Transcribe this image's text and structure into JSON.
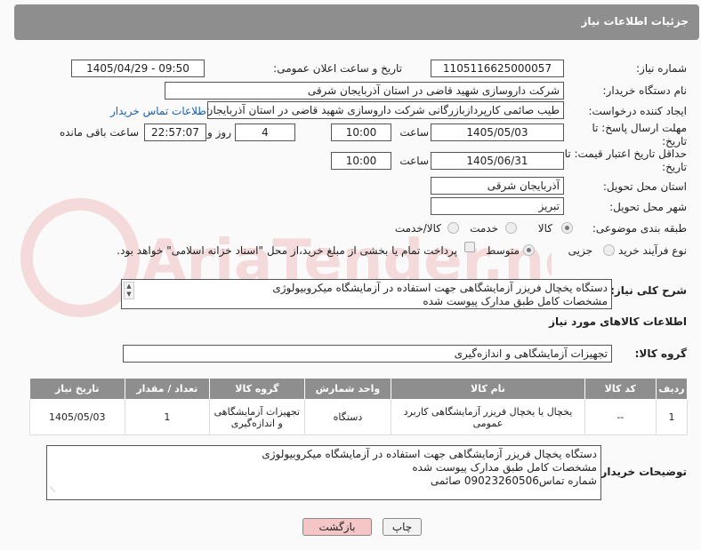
{
  "header": {
    "title": "جزئیات اطلاعات نیاز"
  },
  "fields": {
    "need_number_label": "شماره نیاز:",
    "need_number": "1105116625000057",
    "announce_label": "تاریخ و ساعت اعلان عمومی:",
    "announce_value": "1405/04/29 - 09:50",
    "buyer_org_label": "نام دستگاه خریدار:",
    "buyer_org": "شرکت داروسازی شهید قاضی در استان آذربایجان شرقی",
    "creator_label": "ایجاد کننده درخواست:",
    "creator": "طیب صائمی کارپردازبازرگانی شرکت داروسازی شهید قاضی در استان آذربایجان",
    "contact_link": "اطلاعات تماس خریدار",
    "deadline_label": "مهلت ارسال پاسخ: تا تاریخ:",
    "deadline_date": "1405/05/03",
    "time_label": "ساعت",
    "deadline_time": "10:00",
    "days_value": "4",
    "days_label": "روز و",
    "remaining_time": "22:57:07",
    "remaining_label": "ساعت باقی مانده",
    "validity_label": "حداقل تاریخ اعتبار قیمت: تا تاریخ:",
    "validity_date": "1405/06/31",
    "validity_time": "10:00",
    "province_label": "استان محل تحویل:",
    "province": "آذربایجان شرقی",
    "city_label": "شهر محل تحویل:",
    "city": "تبریز",
    "category_label": "طبقه بندی موضوعی:",
    "category_options": [
      "کالا",
      "خدمت",
      "کالا/خدمت"
    ],
    "process_label": "نوع فرآیند خرید :",
    "process_options": [
      "جزیی",
      "متوسط"
    ],
    "payment_note": "پرداخت تمام یا بخشی از مبلغ خرید،از محل \"اسناد خزانه اسلامی\" خواهد بود."
  },
  "general_desc": {
    "label": "شرح کلی نیاز:",
    "line1": "دستگاه یخچال فریزر آزمایشگاهی جهت استفاده در آزمایشگاه میکروبیولوژی",
    "line2": "مشخصات کامل طبق مدارک پیوست شده"
  },
  "goods_section": {
    "title": "اطلاعات کالاهای مورد نیاز",
    "group_label": "گروه کالا:",
    "group_value": "تجهیزات آزمایشگاهی و اندازه‌گیری"
  },
  "table": {
    "headers": [
      "ردیف",
      "کد کالا",
      "نام کالا",
      "واحد شمارش",
      "گروه کالا",
      "تعداد / مقدار",
      "تاریخ نیاز"
    ],
    "rows": [
      {
        "row": "1",
        "code": "--",
        "name": "یخچال یا یخچال فریزر آزمایشگاهی کاربرد عمومی",
        "unit": "دستگاه",
        "group": "تجهیزات آزمایشگاهی و اندازه‌گیری",
        "qty": "1",
        "date": "1405/05/03"
      }
    ]
  },
  "buyer_notes": {
    "label": "توضیحات خریدار:",
    "line1": "دستگاه یخچال فریزر آزمایشگاهی جهت استفاده در آزمایشگاه میکروبیولوژی",
    "line2": "مشخصات کامل طبق مدارک پیوست شده",
    "line3": "شماره تماس09023260506 صائمی"
  },
  "buttons": {
    "print": "چاپ",
    "back": "بازگشت"
  },
  "watermark": "AriaTender.neT"
}
